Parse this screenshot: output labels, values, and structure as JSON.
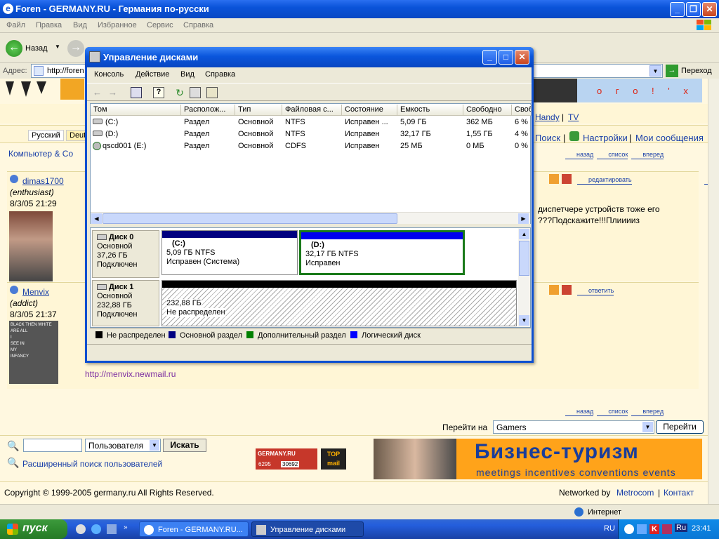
{
  "ie": {
    "title": "Foren - GERMANY.RU - Германия по-русски",
    "menu": [
      "Файл",
      "Правка",
      "Вид",
      "Избранное",
      "Сервис",
      "Справка"
    ],
    "back_label": "Назад",
    "address_label": "Адрес:",
    "address_value": "http://foren",
    "go_label": "Переход",
    "status_zone": "Интернет"
  },
  "page": {
    "lang_ru": "Русский",
    "lang_de": "Deut",
    "breadcrumb": "Компьютер & Со",
    "header_links": [
      "Handy",
      "TV"
    ],
    "nav": [
      "Поиск",
      "Настройки",
      "Мои сообщения"
    ],
    "btn_back": "назад",
    "btn_list": "список",
    "btn_forward": "вперед",
    "btn_edit": "редактировать",
    "btn_reply": "ответить",
    "post1": {
      "user": "dimas1700",
      "rank": "(enthusiast)",
      "date": "8/3/05 21:29",
      "text1": "диспетчере устройств тоже его",
      "text2": "???Подскажите!!!Плииииз"
    },
    "post2": {
      "user": "Menvix",
      "rank": "(addict)",
      "date": "8/3/05 21:37",
      "sig": "http://menvix.newmail.ru",
      "avatar_text": [
        "BLACK THEN WHITE",
        "ARE ALL",
        "I",
        "SEE IN",
        "MY",
        "INFANCY"
      ]
    },
    "goto_label": "Перейти на",
    "goto_value": "Gamers",
    "goto_button": "Перейти",
    "search_scope": "Пользователя",
    "search_button": "Искать",
    "advanced_search": "Расширенный поиск пользователей",
    "counter": [
      "6295",
      "30692"
    ],
    "logo_text": "GERMANY.RU",
    "topmail": "TOP mail",
    "banner_title": "Бизнес-туризм",
    "banner_sub": "meetings incentives conventions events",
    "copyright": "Copyright © 1999-2005 germany.ru All Rights Reserved.",
    "networked": "Networked by",
    "metrocom": "Metrocom",
    "contact": "Контакт",
    "header_deco": "о г о ! ' х"
  },
  "dm": {
    "title": "Управление дисками",
    "menu": [
      "Консоль",
      "Действие",
      "Вид",
      "Справка"
    ],
    "columns": [
      "Том",
      "Располож...",
      "Тип",
      "Файловая с...",
      "Состояние",
      "Емкость",
      "Свободно",
      "Своб"
    ],
    "rows": [
      [
        "(C:)",
        "Раздел",
        "Основной",
        "NTFS",
        "Исправен ...",
        "5,09 ГБ",
        "362 МБ",
        "6 %"
      ],
      [
        "(D:)",
        "Раздел",
        "Основной",
        "NTFS",
        "Исправен",
        "32,17 ГБ",
        "1,55 ГБ",
        "4 %"
      ],
      [
        "qscd001 (E:)",
        "Раздел",
        "Основной",
        "CDFS",
        "Исправен",
        "25 МБ",
        "0 МБ",
        "0 %"
      ]
    ],
    "disk0": {
      "name": "Диск 0",
      "type": "Основной",
      "size": "37,26 ГБ",
      "state": "Подключен"
    },
    "disk1": {
      "name": "Диск 1",
      "type": "Основной",
      "size": "232,88 ГБ",
      "state": "Подключен"
    },
    "partC": {
      "label": "(C:)",
      "size": "5,09 ГБ NTFS",
      "state": "Исправен (Система)"
    },
    "partD": {
      "label": "(D:)",
      "size": "32,17 ГБ NTFS",
      "state": "Исправен"
    },
    "unalloc": {
      "size": "232,88 ГБ",
      "state": "Не распределен"
    },
    "legend": [
      "Не распределен",
      "Основной раздел",
      "Дополнительный раздел",
      "Логический диск"
    ],
    "colors": {
      "unallocated": "#000000",
      "primary": "#000080",
      "extended": "#008000",
      "logical": "#0000ff"
    }
  },
  "taskbar": {
    "start": "пуск",
    "tasks": [
      "Foren - GERMANY.RU...",
      "Управление дисками"
    ],
    "lang": "RU",
    "clock": "23:41",
    "tray_lang": "Ru"
  }
}
